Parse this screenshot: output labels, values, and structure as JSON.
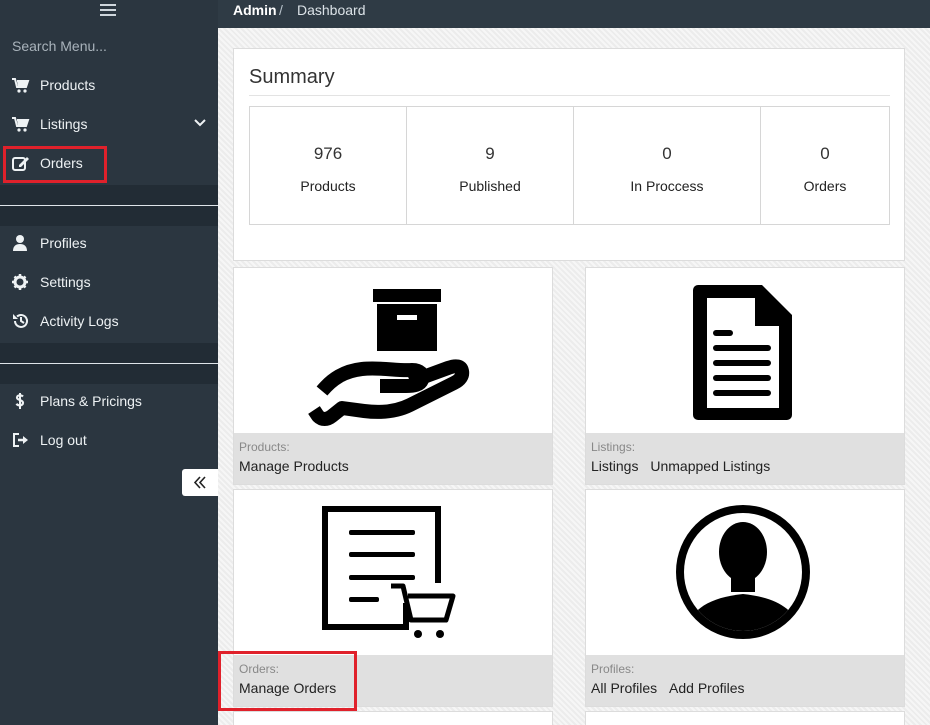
{
  "sidebar": {
    "search_placeholder": "Search Menu...",
    "items": [
      {
        "label": "Products",
        "icon": "cart-icon"
      },
      {
        "label": "Listings",
        "icon": "cart-icon",
        "has_submenu": true
      },
      {
        "label": "Orders",
        "icon": "edit-icon"
      },
      {
        "label": "Profiles",
        "icon": "user-icon"
      },
      {
        "label": "Settings",
        "icon": "gear-icon"
      },
      {
        "label": "Activity Logs",
        "icon": "history-icon"
      },
      {
        "label": "Plans & Pricings",
        "icon": "dollar-icon"
      },
      {
        "label": "Log out",
        "icon": "logout-icon"
      }
    ]
  },
  "breadcrumb": {
    "root": "Admin",
    "separator": "/",
    "current": "Dashboard"
  },
  "summary": {
    "title": "Summary",
    "stats": [
      {
        "value": "976",
        "label": "Products"
      },
      {
        "value": "9",
        "label": "Published"
      },
      {
        "value": "0",
        "label": "In Proccess"
      },
      {
        "value": "0",
        "label": "Orders"
      }
    ]
  },
  "tiles": [
    {
      "category": "Products:",
      "links": [
        "Manage Products"
      ],
      "icon": "hand-box-icon"
    },
    {
      "category": "Listings:",
      "links": [
        "Listings",
        "Unmapped Listings"
      ],
      "icon": "document-icon"
    },
    {
      "category": "Orders:",
      "links": [
        "Manage Orders"
      ],
      "icon": "order-cart-icon"
    },
    {
      "category": "Profiles:",
      "links": [
        "All Profiles",
        "Add Profiles"
      ],
      "icon": "user-avatar-icon"
    }
  ],
  "colors": {
    "sidebar": "#2b3640",
    "topbar": "#2f3b45",
    "highlight": "#e0212b"
  }
}
